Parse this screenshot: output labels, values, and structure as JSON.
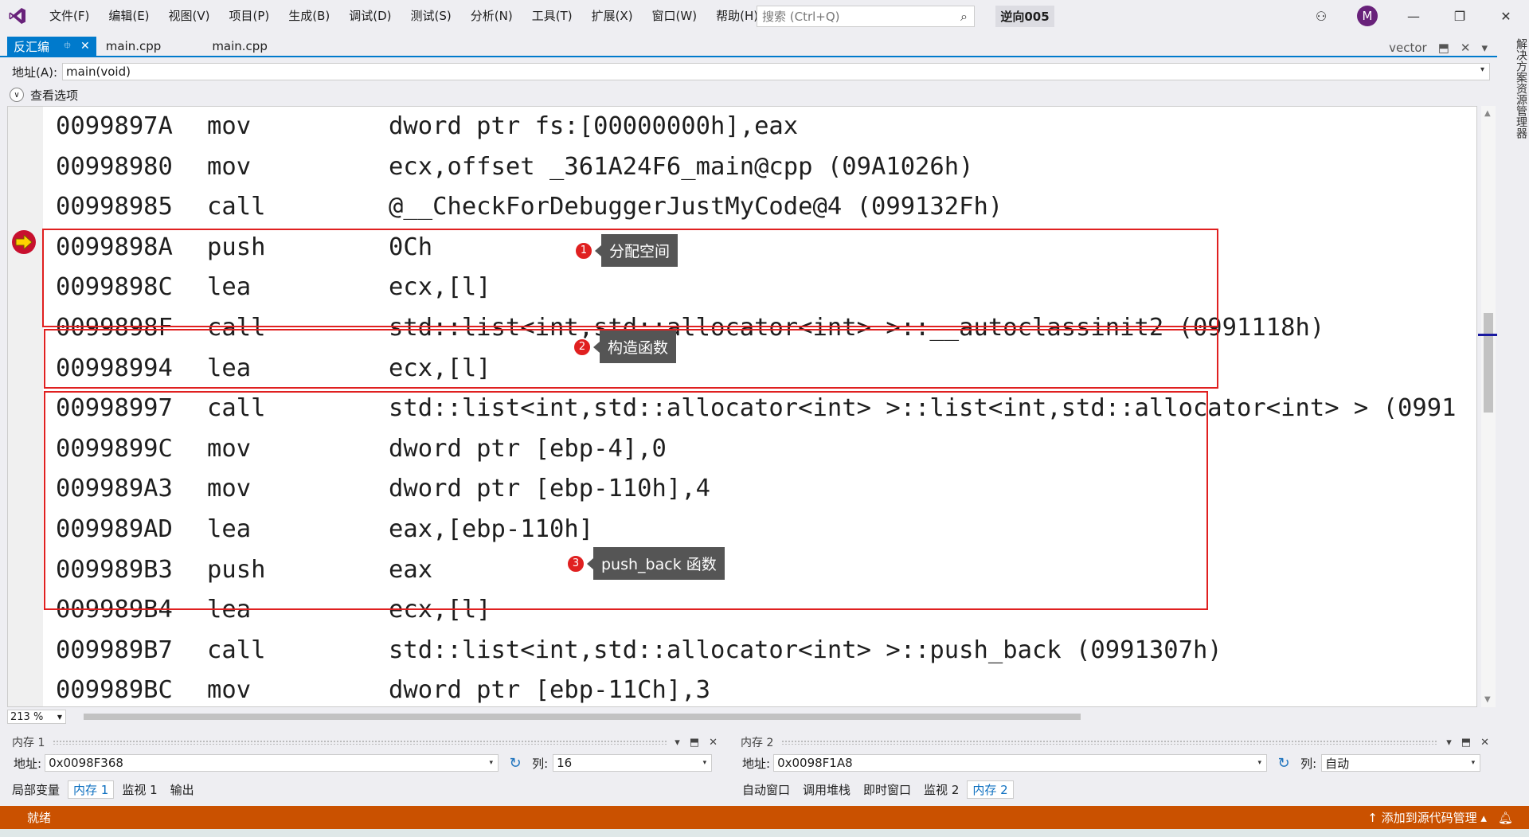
{
  "menu": [
    "文件(F)",
    "编辑(E)",
    "视图(V)",
    "项目(P)",
    "生成(B)",
    "调试(D)",
    "测试(S)",
    "分析(N)",
    "工具(T)",
    "扩展(X)",
    "窗口(W)",
    "帮助(H)"
  ],
  "search": {
    "placeholder": "搜索 (Ctrl+Q)"
  },
  "solution_name": "逆向005",
  "avatar_letter": "M",
  "tabs": {
    "active": "反汇编",
    "t1": "main.cpp",
    "t2": "main.cpp",
    "right_label": "vector"
  },
  "address": {
    "label": "地址(A):",
    "value": "main(void)"
  },
  "view_options": "查看选项",
  "code_lines": [
    {
      "addr": "0099897A",
      "op": "mov",
      "arg": "dword ptr fs:[00000000h],eax"
    },
    {
      "addr": "00998980",
      "op": "mov",
      "arg": "ecx,offset _361A24F6_main@cpp (09A1026h)"
    },
    {
      "addr": "00998985",
      "op": "call",
      "arg": "@__CheckForDebuggerJustMyCode@4 (099132Fh)"
    },
    {
      "addr": "0099898A",
      "op": "push",
      "arg": "0Ch"
    },
    {
      "addr": "0099898C",
      "op": "lea",
      "arg": "ecx,[l]"
    },
    {
      "addr": "0099898F",
      "op": "call",
      "arg": "std::list<int,std::allocator<int> >::__autoclassinit2 (0991118h)"
    },
    {
      "addr": "00998994",
      "op": "lea",
      "arg": "ecx,[l]"
    },
    {
      "addr": "00998997",
      "op": "call",
      "arg": "std::list<int,std::allocator<int> >::list<int,std::allocator<int> > (0991"
    },
    {
      "addr": "0099899C",
      "op": "mov",
      "arg": "dword ptr [ebp-4],0"
    },
    {
      "addr": "009989A3",
      "op": "mov",
      "arg": "dword ptr [ebp-110h],4"
    },
    {
      "addr": "009989AD",
      "op": "lea",
      "arg": "eax,[ebp-110h]"
    },
    {
      "addr": "009989B3",
      "op": "push",
      "arg": "eax"
    },
    {
      "addr": "009989B4",
      "op": "lea",
      "arg": "ecx,[l]"
    },
    {
      "addr": "009989B7",
      "op": "call",
      "arg": "std::list<int,std::allocator<int> >::push_back (0991307h)"
    },
    {
      "addr": "009989BC",
      "op": "mov",
      "arg": "dword ptr [ebp-11Ch],3"
    }
  ],
  "callouts": [
    {
      "num": "1",
      "label": "分配空间"
    },
    {
      "num": "2",
      "label": "构造函数"
    },
    {
      "num": "3",
      "label": "push_back 函数"
    }
  ],
  "zoom": "213 %",
  "side_panel": "解决方案资源管理器",
  "memory1": {
    "title": "内存 1",
    "addr_label": "地址:",
    "addr": "0x0098F368",
    "col_label": "列:",
    "col": "16"
  },
  "memory2": {
    "title": "内存 2",
    "addr_label": "地址:",
    "addr": "0x0098F1A8",
    "col_label": "列:",
    "col": "自动"
  },
  "bottom_tabs_left": [
    "局部变量",
    "内存 1",
    "监视 1",
    "输出"
  ],
  "bottom_tabs_right": [
    "自动窗口",
    "调用堆栈",
    "即时窗口",
    "监视 2",
    "内存 2"
  ],
  "status": {
    "ready": "就绪",
    "source_control": "添加到源代码管理"
  },
  "colors": {
    "accent": "#007acc",
    "status": "#ca5100",
    "highlight_box": "#e02020"
  }
}
